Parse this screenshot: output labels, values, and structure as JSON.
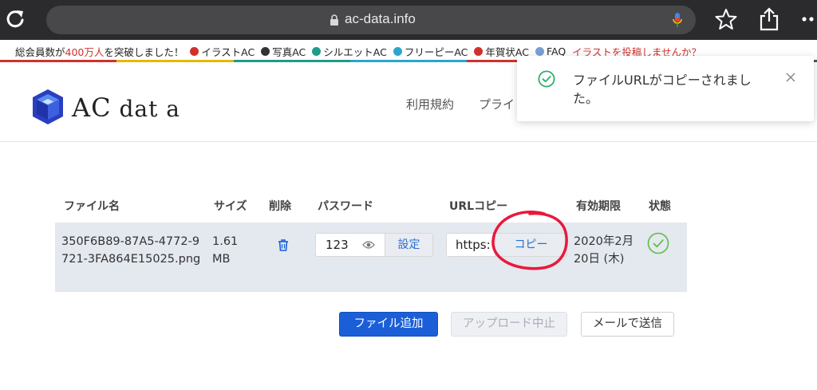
{
  "browser": {
    "url": "ac-data.info",
    "icons": {
      "reload": "reload-icon",
      "lock": "lock-icon",
      "mic": "mic-icon",
      "bookmark": "star-icon",
      "share": "share-icon",
      "more": "more-icon"
    }
  },
  "announcement": {
    "text_prefix": "総会員数が",
    "text_highlight": "400万人",
    "text_suffix": "を突破しました！",
    "links": [
      {
        "label": "イラストAC",
        "color": "#d0312d"
      },
      {
        "label": "写真AC",
        "color": "#333333"
      },
      {
        "label": "シルエットAC",
        "color": "#1e9b8b"
      },
      {
        "label": "フリーピーAC",
        "color": "#2aa6c9"
      },
      {
        "label": "年賀状AC",
        "color": "#d0312d"
      },
      {
        "label": "FAQ",
        "color": "#7a9fd6"
      }
    ],
    "cta": "イラストを投稿しませんか？",
    "stripe_colors": [
      "#d0312d",
      "#e6b800",
      "#1e9b8b",
      "#2aa6c9",
      "#d0312d",
      "#7a9fd6",
      "#555555"
    ]
  },
  "header": {
    "logo_text_big": "AC",
    "logo_text_small": " dat a",
    "nav": [
      "利用規約",
      "プライ"
    ]
  },
  "toast": {
    "message": "ファイルURLがコピーされました。",
    "accent": "#2fae6c"
  },
  "table": {
    "headers": [
      "ファイル名",
      "サイズ",
      "削除",
      "パスワード",
      "URLコピー",
      "有効期限",
      "状態"
    ],
    "row": {
      "filename": "350F6B89-87A5-4772-9721-3FA864E15025.png",
      "size": "1.61 MB",
      "password": "123",
      "set_label": "設定",
      "url_value": "https:",
      "copy_label": "コピー",
      "expiry": "2020年2月20日 (木)",
      "status": "ok"
    }
  },
  "actions": {
    "add": "ファイル追加",
    "stop": "アップロード中止",
    "mail": "メールで送信"
  },
  "colors": {
    "primary": "#1a5fd8",
    "link_blue": "#2e6fd1",
    "success": "#2fae6c",
    "annotation_red": "#e8193c"
  }
}
